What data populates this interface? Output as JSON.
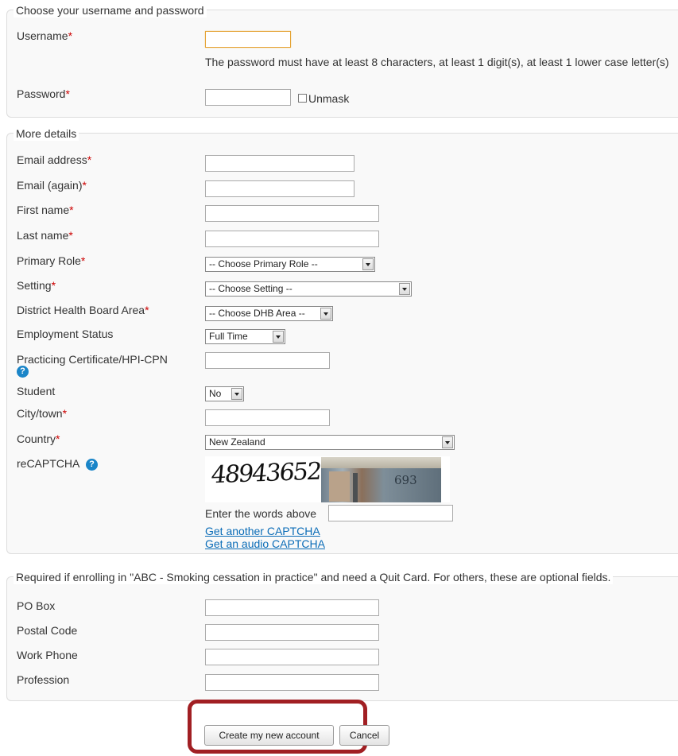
{
  "account": {
    "legend": "Choose your username and password",
    "username_label": "Username",
    "username_value": "",
    "password_policy": "The password must have at least 8 characters, at least 1 digit(s), at least 1 lower case letter(s)",
    "password_label": "Password",
    "password_value": "",
    "unmask_label": "Unmask",
    "required_mark": "*"
  },
  "details": {
    "legend": "More details",
    "email_label": "Email address",
    "email_again_label": "Email (again)",
    "first_name_label": "First name",
    "last_name_label": "Last name",
    "primary_role_label": "Primary Role",
    "primary_role_value": "-- Choose Primary Role --",
    "setting_label": "Setting",
    "setting_value": "-- Choose Setting --",
    "dhb_label": "District Health Board Area",
    "dhb_value": "-- Choose DHB Area --",
    "employment_label": "Employment Status",
    "employment_value": "Full Time",
    "certificate_label": "Practicing Certificate/HPI-CPN",
    "student_label": "Student",
    "student_value": "No",
    "city_label": "City/town",
    "country_label": "Country",
    "country_value": "New Zealand",
    "recaptcha_label": "reCAPTCHA",
    "captcha_text": "48943652",
    "captcha_photo_text": "693",
    "captcha_prompt": "Enter the words above",
    "captcha_another": "Get another CAPTCHA",
    "captcha_audio": "Get an audio CAPTCHA",
    "help_icon": "question-mark-icon"
  },
  "quitcard": {
    "legend": "Required if enrolling in \"ABC - Smoking cessation in practice\" and need a Quit Card. For others, these are optional fields.",
    "po_box_label": "PO Box",
    "postal_code_label": "Postal Code",
    "work_phone_label": "Work Phone",
    "profession_label": "Profession"
  },
  "actions": {
    "create_label": "Create my new account",
    "cancel_label": "Cancel"
  },
  "colors": {
    "required": "#cc0000",
    "link": "#0a6cb7",
    "highlight": "#a11f23",
    "help": "#1a85c8",
    "focus_border": "#e5a233"
  }
}
